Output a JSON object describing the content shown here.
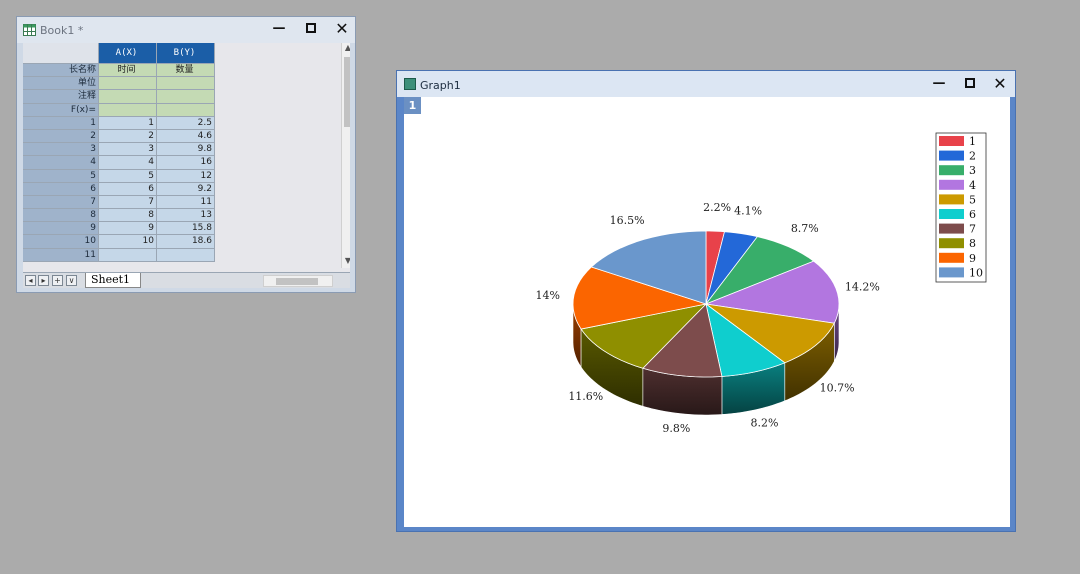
{
  "book": {
    "title": "Book1 *",
    "columns": [
      {
        "header": "A(X)"
      },
      {
        "header": "B(Y)"
      }
    ],
    "meta_rows": [
      {
        "label": "长名称",
        "a": "时间",
        "b": "数量"
      },
      {
        "label": "单位",
        "a": "",
        "b": ""
      },
      {
        "label": "注释",
        "a": "",
        "b": ""
      },
      {
        "label": "F(x)=",
        "a": "",
        "b": ""
      }
    ],
    "rows": [
      {
        "n": "1",
        "a": "1",
        "b": "2.5"
      },
      {
        "n": "2",
        "a": "2",
        "b": "4.6"
      },
      {
        "n": "3",
        "a": "3",
        "b": "9.8"
      },
      {
        "n": "4",
        "a": "4",
        "b": "16"
      },
      {
        "n": "5",
        "a": "5",
        "b": "12"
      },
      {
        "n": "6",
        "a": "6",
        "b": "9.2"
      },
      {
        "n": "7",
        "a": "7",
        "b": "11"
      },
      {
        "n": "8",
        "a": "8",
        "b": "13"
      },
      {
        "n": "9",
        "a": "9",
        "b": "15.8"
      },
      {
        "n": "10",
        "a": "10",
        "b": "18.6"
      },
      {
        "n": "11",
        "a": "",
        "b": ""
      }
    ],
    "sheet_tab": "Sheet1"
  },
  "graph": {
    "title": "Graph1",
    "layer_badge": "1"
  },
  "chart_data": {
    "type": "pie",
    "style": "3d",
    "categories": [
      "1",
      "2",
      "3",
      "4",
      "5",
      "6",
      "7",
      "8",
      "9",
      "10"
    ],
    "values": [
      2.5,
      4.6,
      9.8,
      16,
      12,
      9.2,
      11,
      13,
      15.8,
      18.6
    ],
    "percent_labels": [
      "2.2%",
      "4.1%",
      "8.7%",
      "14.2%",
      "10.7%",
      "8.2%",
      "9.8%",
      "11.6%",
      "14%",
      "16.5%"
    ],
    "colors": [
      "#e8424a",
      "#2368d8",
      "#38ae6a",
      "#b276e0",
      "#cc9a00",
      "#0fcece",
      "#7d4c4c",
      "#8f8f00",
      "#fb6500",
      "#6a97cc"
    ],
    "legend_position": "top-right"
  }
}
